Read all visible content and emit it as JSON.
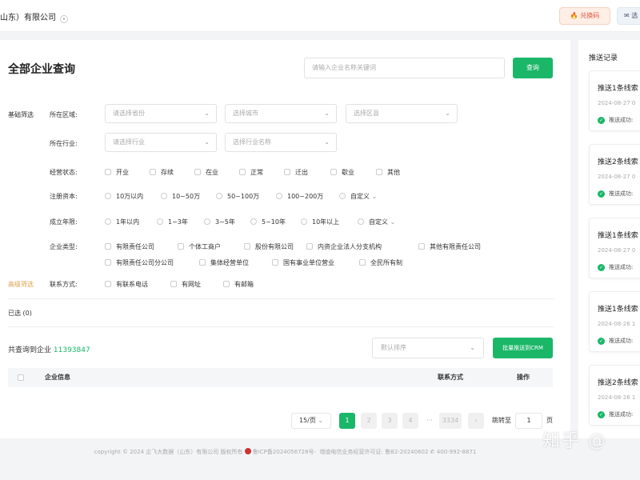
{
  "header": {
    "company": "山东）有限公司",
    "redeem_label": "兑换码",
    "more_label": "选"
  },
  "main": {
    "title": "全部企业查询",
    "search_placeholder": "请输入企业名称关键词",
    "search_button": "查询",
    "basic_filter_label": "基础筛选",
    "advanced_filter_label": "高级筛选",
    "region": {
      "label": "所在区域:",
      "province": "请选择省份",
      "city": "选择城市",
      "district": "选择区县"
    },
    "industry": {
      "label": "所在行业:",
      "industry": "请选择行业",
      "industry_name": "选择行业名称"
    },
    "status": {
      "label": "经营状态:",
      "options": [
        "开业",
        "存续",
        "在业",
        "正常",
        "迁出",
        "歇业",
        "其他"
      ]
    },
    "capital": {
      "label": "注册资本:",
      "options": [
        "10万以内",
        "10~50万",
        "50~100万",
        "100~200万",
        "自定义"
      ]
    },
    "years": {
      "label": "成立年限:",
      "options": [
        "1年以内",
        "1~3年",
        "3~5年",
        "5~10年",
        "10年以上",
        "自定义"
      ]
    },
    "type": {
      "label": "企业类型:",
      "row1": [
        "有限责任公司",
        "个体工商户",
        "股份有限公司",
        "内资企业法人分支机构",
        "其他有限责任公司"
      ],
      "row2": [
        "有限责任公司分公司",
        "集体经营单位",
        "国有事业单位营业",
        "全民所有制"
      ]
    },
    "contact": {
      "label": "联系方式:",
      "options": [
        "有联系电话",
        "有网址",
        "有邮箱"
      ]
    },
    "selected_label": "已选 (0)",
    "found_prefix": "共查询到企业",
    "found_count": "11393847",
    "sort_placeholder": "默认排序",
    "crm_button": "批量推送到CRM",
    "table_headers": {
      "info": "企业信息",
      "contact": "联系方式",
      "action": "操作"
    },
    "pagination": {
      "page_size": "15/页",
      "pages": [
        "1",
        "2",
        "3",
        "4"
      ],
      "ellipsis": "···",
      "last_page": "3334",
      "jump_label": "跳转至",
      "jump_value": "1",
      "page_unit": "页"
    }
  },
  "footer": {
    "copyright": "copyright © 2024 企飞大数据（山东）有限公司 版权所有",
    "icp": "鲁ICP备2024056728号-",
    "license": "增值电信业务经营许可证: 鲁B2-20240602",
    "phone": "400-992-8871"
  },
  "sidebar": {
    "title": "推送记录",
    "records": [
      {
        "title": "推送1条线索",
        "date": "2024-08-27 0",
        "status": "推送成功: "
      },
      {
        "title": "推送2条线索",
        "date": "2024-08-27 0",
        "status": "推送成功: "
      },
      {
        "title": "推送1条线索",
        "date": "2024-08-27 0",
        "status": "推送成功: "
      },
      {
        "title": "推送1条线索",
        "date": "2024-08-26 1",
        "status": "推送成功: "
      },
      {
        "title": "推送2条线索",
        "date": "2024-08-26 1",
        "status": "推送成功: "
      }
    ]
  },
  "watermark": "知乎 @",
  "colors": {
    "accent": "#1ab768",
    "advanced": "#e0a052",
    "redeem": "#e8553f"
  }
}
